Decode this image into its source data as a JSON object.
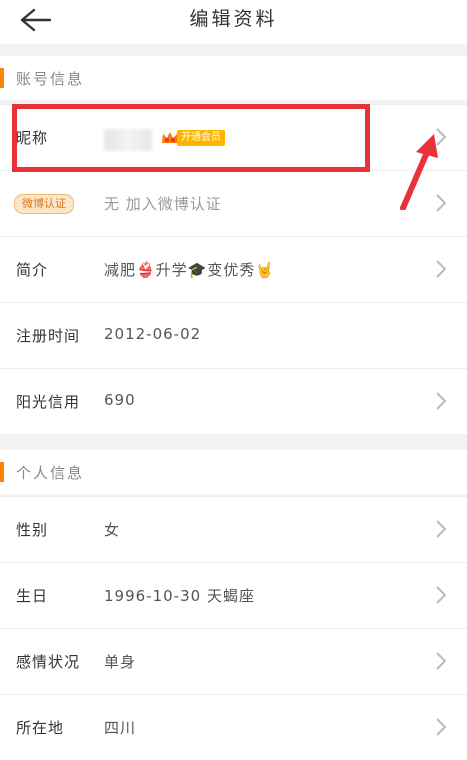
{
  "header": {
    "title": "编辑资料",
    "back_icon": "back-arrow-icon"
  },
  "account_section": {
    "title": "账号信息",
    "accent_color": "#ff8200",
    "nickname": {
      "label": "昵称",
      "vip_badge": "开通会员"
    },
    "weibo_verify": {
      "badge": "微博认证",
      "value": "无 加入微博认证"
    },
    "intro": {
      "label": "简介",
      "value": "减肥👙升学🎓变优秀🤘"
    },
    "register_time": {
      "label": "注册时间",
      "value": "2012-06-02"
    },
    "sunshine_credit": {
      "label": "阳光信用",
      "value": "690"
    }
  },
  "personal_section": {
    "title": "个人信息",
    "gender": {
      "label": "性别",
      "value": "女"
    },
    "birthday": {
      "label": "生日",
      "value": "1996-10-30 天蝎座"
    },
    "relationship": {
      "label": "感情状况",
      "value": "单身"
    },
    "location": {
      "label": "所在地",
      "value": "四川"
    }
  },
  "annotation": {
    "highlight_color": "#e8323a"
  }
}
